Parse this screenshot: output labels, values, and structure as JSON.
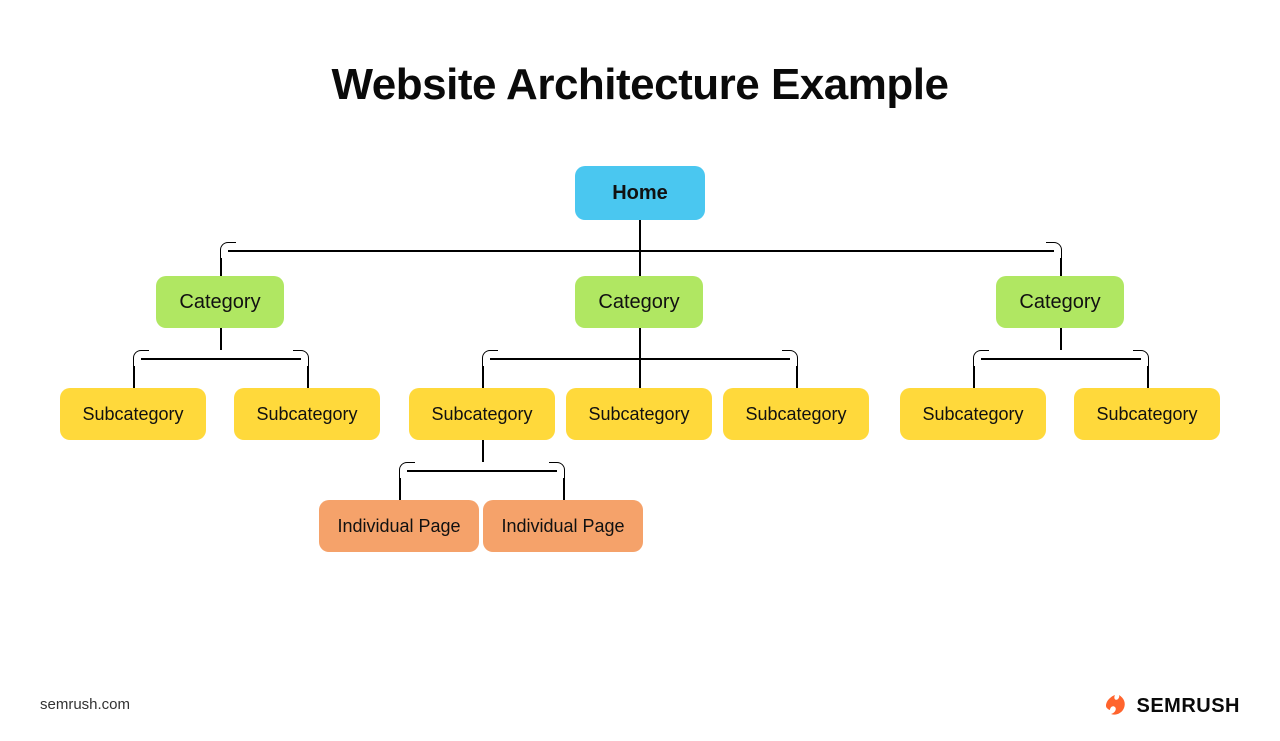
{
  "title": "Website Architecture Example",
  "attribution": "semrush.com",
  "brand": "SEMRUSH",
  "colors": {
    "home": "#4ac7f0",
    "category": "#b0e762",
    "subcategory": "#ffd93b",
    "individual": "#f5a26a",
    "brand_accent": "#ff642d"
  },
  "tree": {
    "label": "Home",
    "type": "home",
    "children": [
      {
        "label": "Category",
        "type": "category",
        "children": [
          {
            "label": "Subcategory",
            "type": "subcategory"
          },
          {
            "label": "Subcategory",
            "type": "subcategory"
          }
        ]
      },
      {
        "label": "Category",
        "type": "category",
        "children": [
          {
            "label": "Subcategory",
            "type": "subcategory",
            "children": [
              {
                "label": "Individual Page",
                "type": "individual"
              },
              {
                "label": "Individual Page",
                "type": "individual"
              }
            ]
          },
          {
            "label": "Subcategory",
            "type": "subcategory"
          },
          {
            "label": "Subcategory",
            "type": "subcategory"
          }
        ]
      },
      {
        "label": "Category",
        "type": "category",
        "children": [
          {
            "label": "Subcategory",
            "type": "subcategory"
          },
          {
            "label": "Subcategory",
            "type": "subcategory"
          }
        ]
      }
    ]
  }
}
